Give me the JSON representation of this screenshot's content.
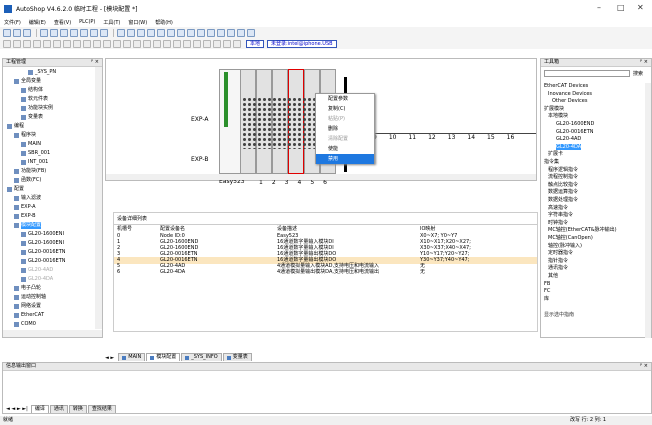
{
  "window": {
    "title": "AutoShop V4.6.2.0 临时工程 - [模块配置 *]",
    "minimize": "–",
    "maximize": "□",
    "close": "✕"
  },
  "menu": [
    "文件(F)",
    "编辑(E)",
    "查看(V)",
    "PLC(P)",
    "工具(T)",
    "窗口(W)",
    "帮助(H)"
  ],
  "toolbar2": {
    "run_label": "本地",
    "device_label": "未登录:intel@iphone.USB"
  },
  "left_panel": {
    "title": "工程管理",
    "pin": "ᵖ ×",
    "items": [
      {
        "label": "_SYS_PN",
        "indent": 3,
        "icon": "star-icon"
      },
      {
        "label": "全局变量",
        "indent": 1,
        "icon": "folder-icon"
      },
      {
        "label": "结构体",
        "indent": 2,
        "icon": "struct-icon"
      },
      {
        "label": "软元件表",
        "indent": 2,
        "icon": "table-icon"
      },
      {
        "label": "功能块实例",
        "indent": 2,
        "icon": "block-icon"
      },
      {
        "label": "变量表",
        "indent": 2,
        "icon": "table-icon"
      },
      {
        "label": "编程",
        "indent": 0,
        "icon": "folder-icon"
      },
      {
        "label": "程序块",
        "indent": 1,
        "icon": "folder-icon"
      },
      {
        "label": "MAIN",
        "indent": 2,
        "icon": "doc-icon"
      },
      {
        "label": "SBR_001",
        "indent": 2,
        "icon": "doc-icon"
      },
      {
        "label": "INT_001",
        "indent": 2,
        "icon": "doc-icon"
      },
      {
        "label": "功能块(FB)",
        "indent": 1,
        "icon": "fb-icon"
      },
      {
        "label": "函数(FC)",
        "indent": 1,
        "icon": "fc-icon"
      },
      {
        "label": "配置",
        "indent": 0,
        "icon": "folder-icon"
      },
      {
        "label": "输入滤波",
        "indent": 1,
        "icon": "filter-icon"
      },
      {
        "label": "EXP-A",
        "indent": 1,
        "icon": "module-icon"
      },
      {
        "label": "EXP-B",
        "indent": 1,
        "icon": "module-icon"
      },
      {
        "label": "模块配置",
        "indent": 1,
        "icon": "module-icon",
        "selected": true
      },
      {
        "label": "GL20-1600ENI",
        "indent": 2,
        "icon": "module-icon"
      },
      {
        "label": "GL20-1600ENI",
        "indent": 2,
        "icon": "module-icon"
      },
      {
        "label": "GL20-0016ETN",
        "indent": 2,
        "icon": "module-icon"
      },
      {
        "label": "GL20-0016ETN",
        "indent": 2,
        "icon": "module-icon"
      },
      {
        "label": "GL20-4AD",
        "indent": 2,
        "icon": "module-icon",
        "dim": true
      },
      {
        "label": "GL20-4DA",
        "indent": 2,
        "icon": "module-icon",
        "dim": true
      },
      {
        "label": "电子凸轮",
        "indent": 1,
        "icon": "cam-icon"
      },
      {
        "label": "运动控制轴",
        "indent": 1,
        "icon": "axis-icon"
      },
      {
        "label": "网络设置",
        "indent": 1,
        "icon": "net-icon"
      },
      {
        "label": "EtherCAT",
        "indent": 1,
        "icon": "ecat-icon"
      },
      {
        "label": "COM0",
        "indent": 1,
        "icon": "com-icon"
      }
    ]
  },
  "canvas": {
    "label_a": "EXP-A",
    "label_b": "EXP-B",
    "label_easy": "Easy523",
    "slots_top": [
      "9",
      "10",
      "11",
      "12",
      "13",
      "14",
      "15",
      "16"
    ],
    "slots_bottom": [
      "1",
      "2",
      "3",
      "4",
      "5",
      "6"
    ]
  },
  "context_menu": {
    "items": [
      {
        "label": "配置参数",
        "state": "normal"
      },
      {
        "label": "复制(C)",
        "state": "normal"
      },
      {
        "label": "粘贴(P)",
        "state": "disabled"
      },
      {
        "label": "删除",
        "state": "normal"
      },
      {
        "label": "清除配置",
        "state": "disabled"
      },
      {
        "label": "使能",
        "state": "normal"
      },
      {
        "label": "禁用",
        "state": "highlight"
      }
    ]
  },
  "table": {
    "title": "设备详细列表",
    "headers": [
      "机槽号",
      "配置设备名",
      "设备描述",
      "IO映射"
    ],
    "rows": [
      {
        "slot": "0",
        "name": "Node ID:0",
        "desc": "Easy523",
        "io": "X0~X7; Y0~Y7"
      },
      {
        "slot": "1",
        "name": "GL20-1600END",
        "desc": "16通道数字量输入模块DI",
        "io": "X10~X17;X20~X27;"
      },
      {
        "slot": "2",
        "name": "GL20-1600END",
        "desc": "16通道数字量输入模块DI",
        "io": "X30~X37;X40~X47;"
      },
      {
        "slot": "3",
        "name": "GL20-0016ETN",
        "desc": "16通道数字量输出模块DO",
        "io": "Y10~Y17;Y20~Y27;"
      },
      {
        "slot": "4",
        "name": "GL20-0016ETN",
        "desc": "16通道数字量输出模块DO",
        "io": "Y30~Y37;Y40~Y47;",
        "selected": true
      },
      {
        "slot": "5",
        "name": "GL20-4AD",
        "desc": "4通道模拟量输入模块AD,支持电压和电流输入",
        "io": "无"
      },
      {
        "slot": "6",
        "name": "GL20-4DA",
        "desc": "4通道模拟量输出模块DA,支持电压和电流输出",
        "io": "无"
      }
    ]
  },
  "tabs": [
    {
      "label": "MAIN"
    },
    {
      "label": "模块配置",
      "active": true
    },
    {
      "label": "_SYS_INFO"
    },
    {
      "label": "变量表"
    }
  ],
  "right_panel": {
    "title": "工具箱",
    "pin": "ᵖ ×",
    "search_label": "搜索",
    "items": [
      {
        "label": "EtherCAT Devices",
        "x": 3
      },
      {
        "label": "Inovance Devices",
        "x": 7
      },
      {
        "label": "Other Devices",
        "x": 11
      },
      {
        "label": "扩展模块",
        "x": 3
      },
      {
        "label": "本地模块",
        "x": 7
      },
      {
        "label": "GL20-1600END",
        "x": 15
      },
      {
        "label": "GL20-0016ETN",
        "x": 15
      },
      {
        "label": "GL20-4AD",
        "x": 15
      },
      {
        "label": "GL20-4DA",
        "x": 15,
        "selected": true
      },
      {
        "label": "扩展卡",
        "x": 7
      },
      {
        "label": "指令集",
        "x": 3
      },
      {
        "label": "程序逻辑指令",
        "x": 7
      },
      {
        "label": "流程控制指令",
        "x": 7
      },
      {
        "label": "触点比较指令",
        "x": 7
      },
      {
        "label": "数据运算指令",
        "x": 7
      },
      {
        "label": "数据处理指令",
        "x": 7
      },
      {
        "label": "高速指令",
        "x": 7
      },
      {
        "label": "字符串指令",
        "x": 7
      },
      {
        "label": "时钟指令",
        "x": 7
      },
      {
        "label": "MC轴控(EtherCAT&脉冲输出)",
        "x": 7
      },
      {
        "label": "MC轴控(CanOpen)",
        "x": 7
      },
      {
        "label": "轴控(脉冲输入)",
        "x": 7
      },
      {
        "label": "定时器指令",
        "x": 7
      },
      {
        "label": "指针指令",
        "x": 7
      },
      {
        "label": "通讯指令",
        "x": 7
      },
      {
        "label": "其他",
        "x": 7
      },
      {
        "label": "FB",
        "x": 3
      },
      {
        "label": "FC",
        "x": 3
      },
      {
        "label": "库",
        "x": 3
      }
    ],
    "footer": "显示选中指南"
  },
  "output": {
    "title": "信息输出窗口",
    "pin": "ᵖ ×",
    "tabs": [
      "编译",
      "通讯",
      "转换",
      "查找结果"
    ]
  },
  "status": {
    "left": "就绪",
    "right": "改写  行: 2  列: 1"
  }
}
